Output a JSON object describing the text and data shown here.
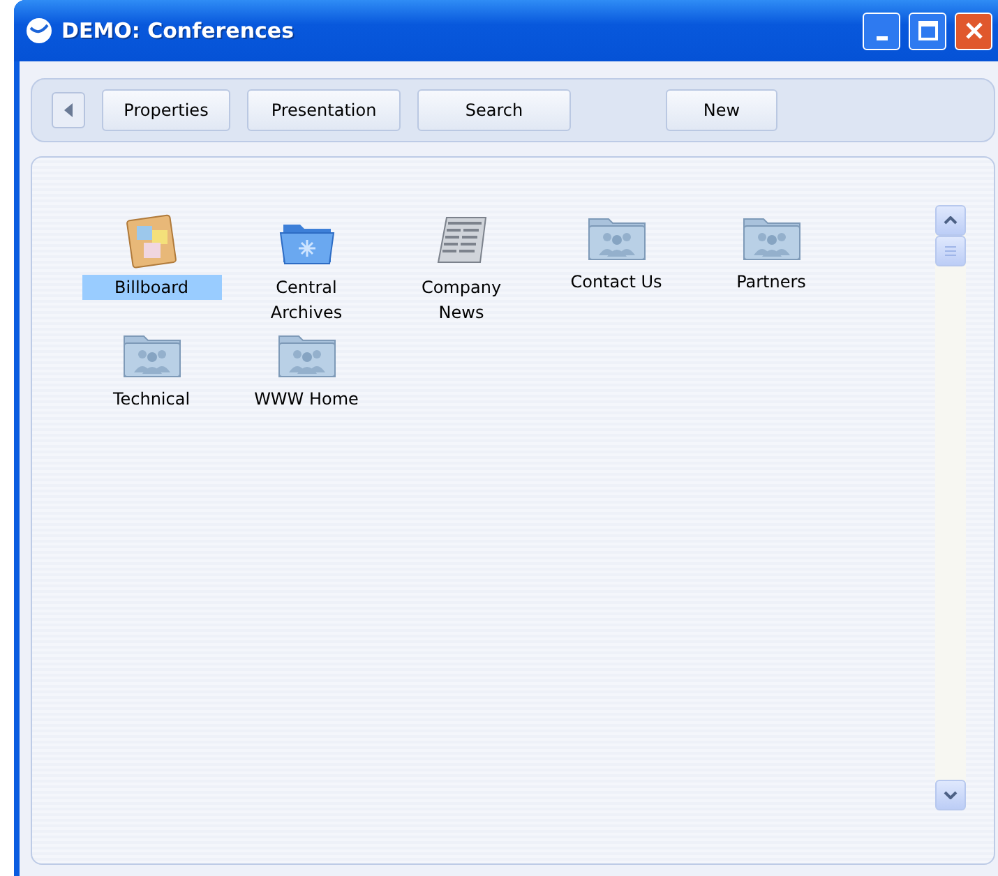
{
  "window": {
    "title": "DEMO: Conferences"
  },
  "toolbar": {
    "buttons": [
      "Properties",
      "Presentation",
      "Search",
      "New"
    ]
  },
  "items": [
    {
      "label": "Billboard",
      "kind": "billboard",
      "selected": true
    },
    {
      "label": "Central Archives",
      "kind": "archive",
      "selected": false
    },
    {
      "label": "Company News",
      "kind": "news",
      "selected": false
    },
    {
      "label": "Contact Us",
      "kind": "group",
      "selected": false
    },
    {
      "label": "Partners",
      "kind": "group",
      "selected": false
    },
    {
      "label": "Technical",
      "kind": "group",
      "selected": false
    },
    {
      "label": "WWW Home",
      "kind": "group",
      "selected": false
    }
  ]
}
